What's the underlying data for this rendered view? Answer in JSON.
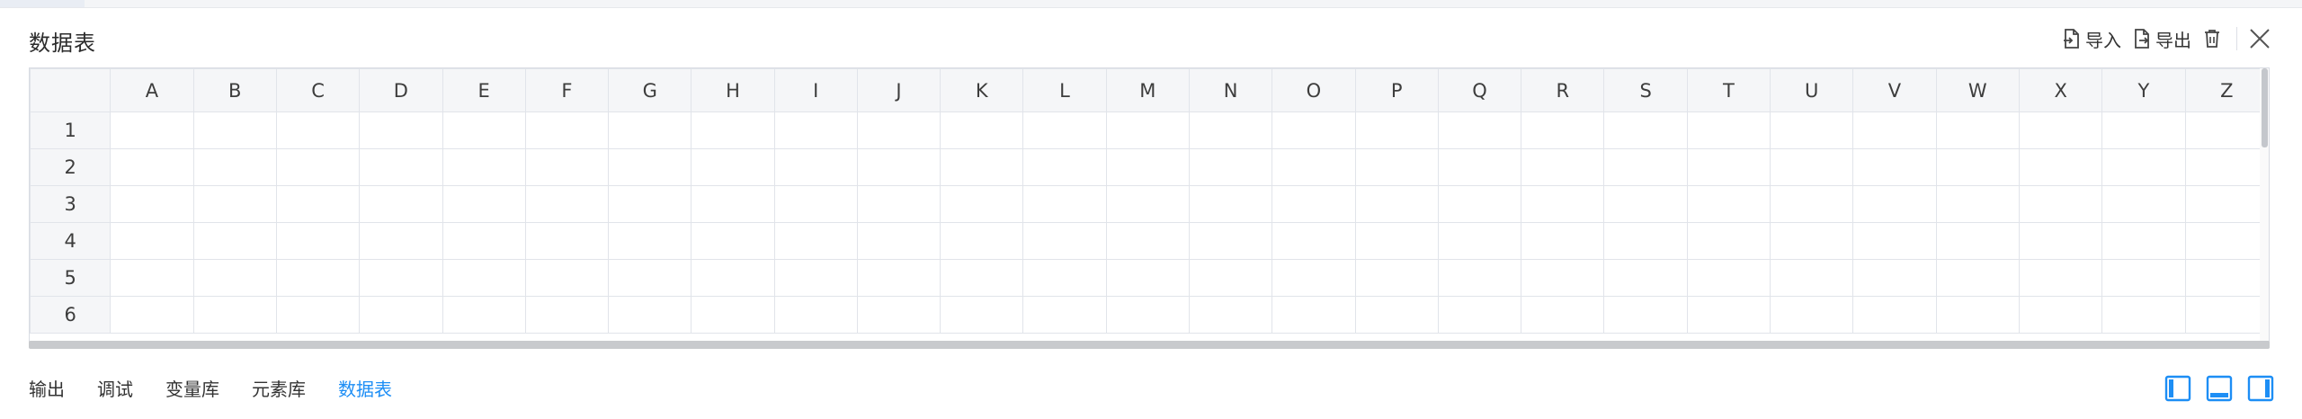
{
  "panel": {
    "title": "数据表"
  },
  "toolbar": {
    "import_label": "导入",
    "export_label": "导出"
  },
  "sheet": {
    "columns": [
      "A",
      "B",
      "C",
      "D",
      "E",
      "F",
      "G",
      "H",
      "I",
      "J",
      "K",
      "L",
      "M",
      "N",
      "O",
      "P",
      "Q",
      "R",
      "S",
      "T",
      "U",
      "V",
      "W",
      "X",
      "Y",
      "Z"
    ],
    "rows": [
      "1",
      "2",
      "3",
      "4",
      "5",
      "6"
    ]
  },
  "bottom_tabs": [
    {
      "label": "输出",
      "active": false
    },
    {
      "label": "调试",
      "active": false
    },
    {
      "label": "变量库",
      "active": false
    },
    {
      "label": "元素库",
      "active": false
    },
    {
      "label": "数据表",
      "active": true
    }
  ],
  "colors": {
    "accent": "#1d8ef5",
    "header_bg": "#f5f6f8",
    "grid_line": "#e1e4ea"
  },
  "icons": {
    "import": "file-import-icon",
    "export": "file-export-icon",
    "clear": "trash-icon",
    "close": "close-icon",
    "layout_left": "dock-left-icon",
    "layout_bottom": "dock-bottom-icon",
    "layout_right": "dock-right-icon"
  }
}
